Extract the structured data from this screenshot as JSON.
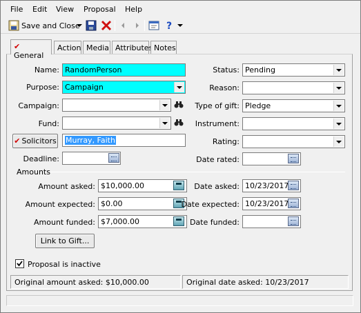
{
  "menubar": [
    "File",
    "Edit",
    "View",
    "Proposal",
    "Help"
  ],
  "toolbar": {
    "save_close_label": "Save and Close"
  },
  "tabs": [
    "General",
    "Action",
    "Media",
    "Attributes",
    "Notes"
  ],
  "form": {
    "name_label": "Name:",
    "name_value": "RandomPerson",
    "purpose_label": "Purpose:",
    "purpose_value": "Campaign",
    "campaign_label": "Campaign:",
    "campaign_value": "",
    "fund_label": "Fund:",
    "fund_value": "",
    "solicitors_button": "Solicitors",
    "solicitor_value": "Murray, Faith",
    "deadline_label": "Deadline:",
    "deadline_value": "",
    "status_label": "Status:",
    "status_value": "Pending",
    "reason_label": "Reason:",
    "reason_value": "",
    "gift_type_label": "Type of gift:",
    "gift_type_value": "Pledge",
    "instrument_label": "Instrument:",
    "instrument_value": "",
    "rating_label": "Rating:",
    "rating_value": "",
    "date_rated_label": "Date rated:",
    "date_rated_value": ""
  },
  "amounts": {
    "section_label": "Amounts",
    "asked_label": "Amount asked:",
    "asked_value": "$10,000.00",
    "expected_label": "Amount expected:",
    "expected_value": "$0.00",
    "funded_label": "Amount funded:",
    "funded_value": "$7,000.00",
    "date_asked_label": "Date asked:",
    "date_asked_value": "10/23/2017",
    "date_expected_label": "Date expected:",
    "date_expected_value": "10/23/2017",
    "date_funded_label": "Date funded:",
    "date_funded_value": ""
  },
  "link_button": "Link to Gift...",
  "inactive_label": "Proposal is inactive",
  "inactive_checked": true,
  "status_bar": {
    "original_amount": "Original amount asked: $10,000.00",
    "original_date": "Original date asked: 10/23/2017"
  },
  "colors": {
    "highlight_field": "#00ffff",
    "selection": "#3399ff",
    "check_red": "#d00000"
  }
}
